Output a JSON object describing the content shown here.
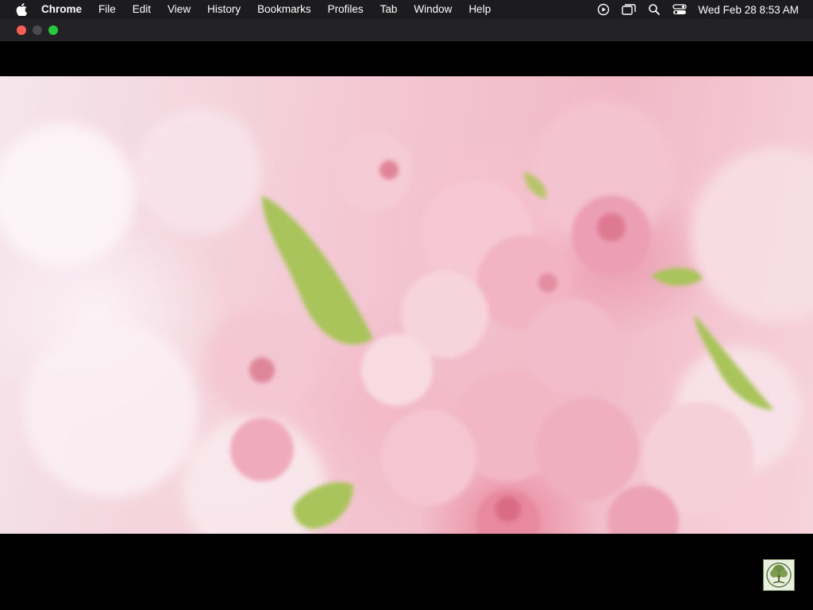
{
  "menubar": {
    "app_name": "Chrome",
    "items": [
      "File",
      "Edit",
      "View",
      "History",
      "Bookmarks",
      "Profiles",
      "Tab",
      "Window",
      "Help"
    ],
    "status_icons": [
      "play-circle-icon",
      "screen-mirroring-icon",
      "spotlight-search-icon",
      "control-center-icon"
    ],
    "clock": "Wed Feb 28  8:53 AM"
  },
  "window": {
    "traffic_lights": [
      "close",
      "minimize",
      "maximize"
    ]
  },
  "video": {
    "subject": "pink cherry blossoms",
    "watermark_icon": "tree-logo-icon"
  },
  "colors": {
    "menubar_bg": "#1c1c1e",
    "titlebar_bg": "#232325",
    "close": "#ff5f57",
    "minimize": "#4a4a4c",
    "maximize": "#28c840",
    "blossom_pink": "#f1b8c6",
    "leaf_green": "#a9c45a"
  }
}
